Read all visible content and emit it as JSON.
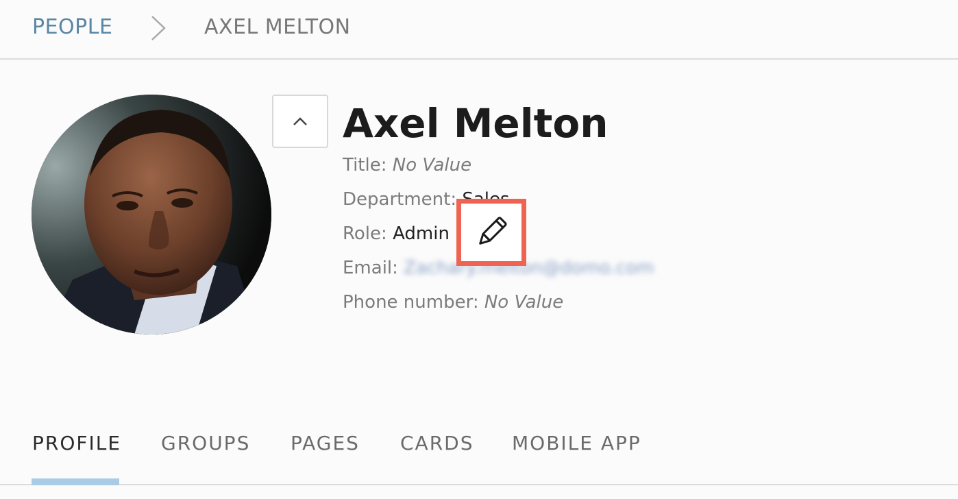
{
  "breadcrumb": {
    "root": "PEOPLE",
    "current": "AXEL MELTON"
  },
  "profile": {
    "name": "Axel Melton",
    "fields": {
      "title_label": "Title:",
      "title_value": "No Value",
      "department_label": "Department:",
      "department_value": "Sales",
      "role_label": "Role:",
      "role_value": "Admin",
      "email_label": "Email:",
      "email_value": "Zachary.melton@domo.com",
      "phone_label": "Phone number:",
      "phone_value": "No Value"
    }
  },
  "icons": {
    "breadcrumb_separator": "chevron-right-icon",
    "collapse": "chevron-up-icon",
    "edit": "pencil-icon"
  },
  "colors": {
    "link": "#5a86a6",
    "highlight": "#ee6352",
    "active_tab_underline": "#a9cbe6"
  },
  "tabs": [
    {
      "label": "PROFILE",
      "active": true
    },
    {
      "label": "GROUPS",
      "active": false
    },
    {
      "label": "PAGES",
      "active": false
    },
    {
      "label": "CARDS",
      "active": false
    },
    {
      "label": "MOBILE APP",
      "active": false
    }
  ]
}
